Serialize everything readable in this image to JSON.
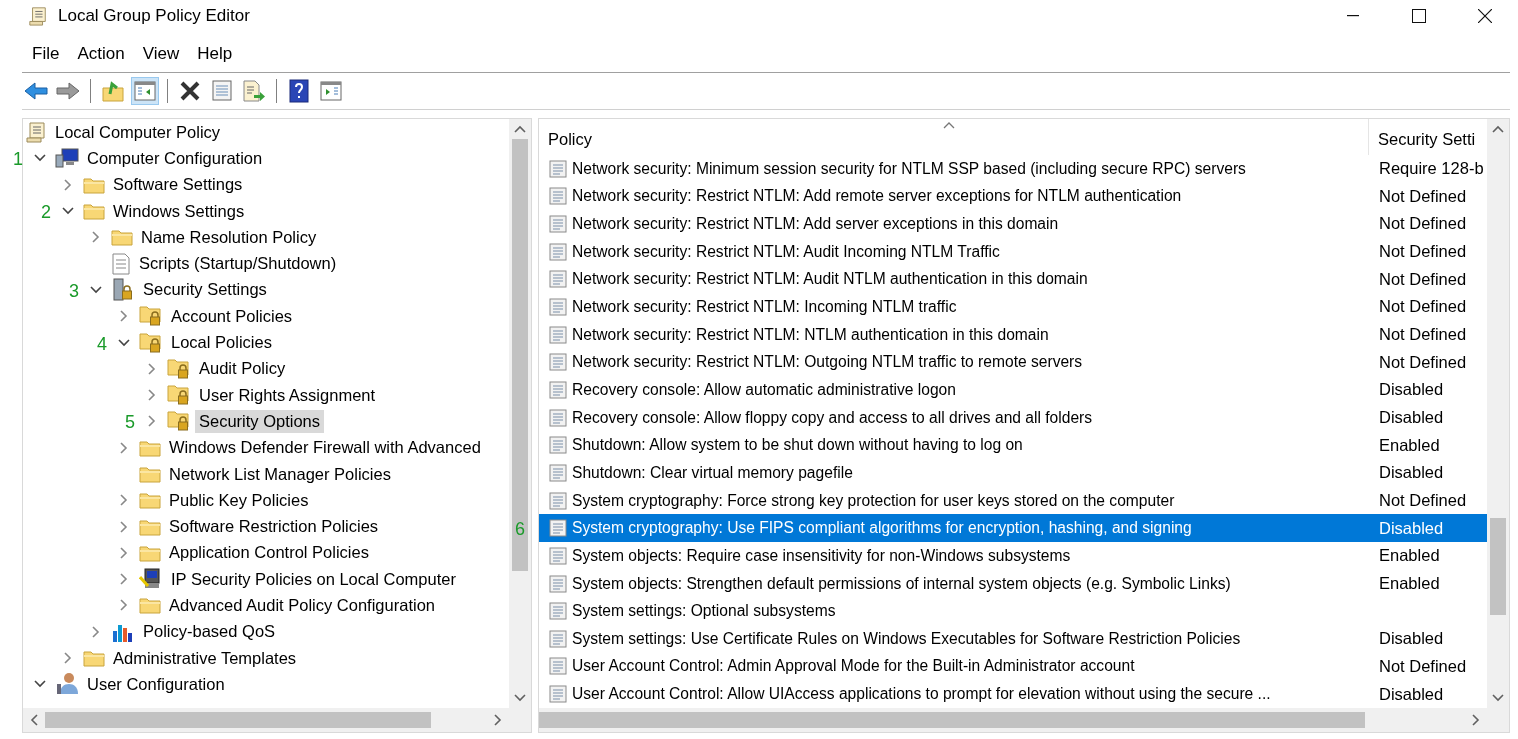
{
  "window": {
    "title": "Local Group Policy Editor"
  },
  "menu": [
    "File",
    "Action",
    "View",
    "Help"
  ],
  "toolbar": [
    [
      {
        "kind": "back",
        "pressed": false
      },
      {
        "kind": "forward",
        "pressed": false
      }
    ],
    [
      {
        "kind": "up",
        "pressed": false
      },
      {
        "kind": "tree-toggle",
        "pressed": true
      }
    ],
    [
      {
        "kind": "delete",
        "pressed": false
      },
      {
        "kind": "properties",
        "pressed": false
      },
      {
        "kind": "export",
        "pressed": false
      }
    ],
    [
      {
        "kind": "help",
        "pressed": false
      },
      {
        "kind": "action-toggle",
        "pressed": false
      }
    ]
  ],
  "tree": [
    {
      "label": "Local Computer Policy",
      "kind": "scroll",
      "selected": false,
      "children": [
        {
          "label": "Computer Configuration",
          "kind": "computer",
          "expanded": true,
          "selected": false,
          "annotation": "1",
          "children": [
            {
              "label": "Software Settings",
              "kind": "folder",
              "expanded": false,
              "selected": false
            },
            {
              "label": "Windows Settings",
              "kind": "folder",
              "expanded": true,
              "selected": false,
              "annotation": "2",
              "children": [
                {
                  "label": "Name Resolution Policy",
                  "kind": "folder",
                  "expanded": false,
                  "selected": false
                },
                {
                  "label": "Scripts (Startup/Shutdown)",
                  "kind": "script",
                  "selected": false
                },
                {
                  "label": "Security Settings",
                  "kind": "server-lock",
                  "expanded": true,
                  "selected": false,
                  "annotation": "3",
                  "children": [
                    {
                      "label": "Account Policies",
                      "kind": "locked-folder",
                      "expanded": false,
                      "selected": false
                    },
                    {
                      "label": "Local Policies",
                      "kind": "locked-folder",
                      "expanded": true,
                      "selected": false,
                      "annotation": "4",
                      "children": [
                        {
                          "label": "Audit Policy",
                          "kind": "locked-folder",
                          "expanded": false,
                          "selected": false
                        },
                        {
                          "label": "User Rights Assignment",
                          "kind": "locked-folder",
                          "expanded": false,
                          "selected": false
                        },
                        {
                          "label": "Security Options",
                          "kind": "locked-folder",
                          "expanded": false,
                          "selected": true,
                          "annotation": "5"
                        }
                      ]
                    },
                    {
                      "label": "Windows Defender Firewall with Advanced",
                      "kind": "folder",
                      "expanded": false,
                      "selected": false
                    },
                    {
                      "label": "Network List Manager Policies",
                      "kind": "folder",
                      "selected": false
                    },
                    {
                      "label": "Public Key Policies",
                      "kind": "folder",
                      "expanded": false,
                      "selected": false
                    },
                    {
                      "label": "Software Restriction Policies",
                      "kind": "folder",
                      "expanded": false,
                      "selected": false
                    },
                    {
                      "label": "Application Control Policies",
                      "kind": "folder",
                      "expanded": false,
                      "selected": false
                    },
                    {
                      "label": "IP Security Policies on Local Computer",
                      "kind": "network",
                      "expanded": false,
                      "selected": false
                    },
                    {
                      "label": "Advanced Audit Policy Configuration",
                      "kind": "folder",
                      "expanded": false,
                      "selected": false
                    }
                  ]
                },
                {
                  "label": "Policy-based QoS",
                  "kind": "chart",
                  "expanded": false,
                  "selected": false
                }
              ]
            },
            {
              "label": "Administrative Templates",
              "kind": "folder",
              "expanded": false,
              "selected": false
            }
          ]
        },
        {
          "label": "User Configuration",
          "kind": "user",
          "expanded": true,
          "selected": false
        }
      ]
    }
  ],
  "table": {
    "columns": [
      "Policy",
      "Security Setti"
    ],
    "rows": [
      {
        "policy": "Network security: Minimum session security for NTLM SSP based (including secure RPC) servers",
        "setting": "Require 128-b",
        "selected": false
      },
      {
        "policy": "Network security: Restrict NTLM: Add remote server exceptions for NTLM authentication",
        "setting": "Not Defined",
        "selected": false
      },
      {
        "policy": "Network security: Restrict NTLM: Add server exceptions in this domain",
        "setting": "Not Defined",
        "selected": false
      },
      {
        "policy": "Network security: Restrict NTLM: Audit Incoming NTLM Traffic",
        "setting": "Not Defined",
        "selected": false
      },
      {
        "policy": "Network security: Restrict NTLM: Audit NTLM authentication in this domain",
        "setting": "Not Defined",
        "selected": false
      },
      {
        "policy": "Network security: Restrict NTLM: Incoming NTLM traffic",
        "setting": "Not Defined",
        "selected": false
      },
      {
        "policy": "Network security: Restrict NTLM: NTLM authentication in this domain",
        "setting": "Not Defined",
        "selected": false
      },
      {
        "policy": "Network security: Restrict NTLM: Outgoing NTLM traffic to remote servers",
        "setting": "Not Defined",
        "selected": false
      },
      {
        "policy": "Recovery console: Allow automatic administrative logon",
        "setting": "Disabled",
        "selected": false
      },
      {
        "policy": "Recovery console: Allow floppy copy and access to all drives and all folders",
        "setting": "Disabled",
        "selected": false
      },
      {
        "policy": "Shutdown: Allow system to be shut down without having to log on",
        "setting": "Enabled",
        "selected": false
      },
      {
        "policy": "Shutdown: Clear virtual memory pagefile",
        "setting": "Disabled",
        "selected": false
      },
      {
        "policy": "System cryptography: Force strong key protection for user keys stored on the computer",
        "setting": "Not Defined",
        "selected": false
      },
      {
        "policy": "System cryptography: Use FIPS compliant algorithms for encryption, hashing, and signing",
        "setting": "Disabled",
        "selected": true,
        "annotation": "6"
      },
      {
        "policy": "System objects: Require case insensitivity for non-Windows subsystems",
        "setting": "Enabled",
        "selected": false
      },
      {
        "policy": "System objects: Strengthen default permissions of internal system objects (e.g. Symbolic Links)",
        "setting": "Enabled",
        "selected": false
      },
      {
        "policy": "System settings: Optional subsystems",
        "selected": false
      },
      {
        "policy": "System settings: Use Certificate Rules on Windows Executables for Software Restriction Policies",
        "setting": "Disabled",
        "selected": false
      },
      {
        "policy": "User Account Control: Admin Approval Mode for the Built-in Administrator account",
        "setting": "Not Defined",
        "selected": false
      },
      {
        "policy": "User Account Control: Allow UIAccess applications to prompt for elevation without using the secure ...",
        "setting": "Disabled",
        "selected": false
      }
    ]
  }
}
